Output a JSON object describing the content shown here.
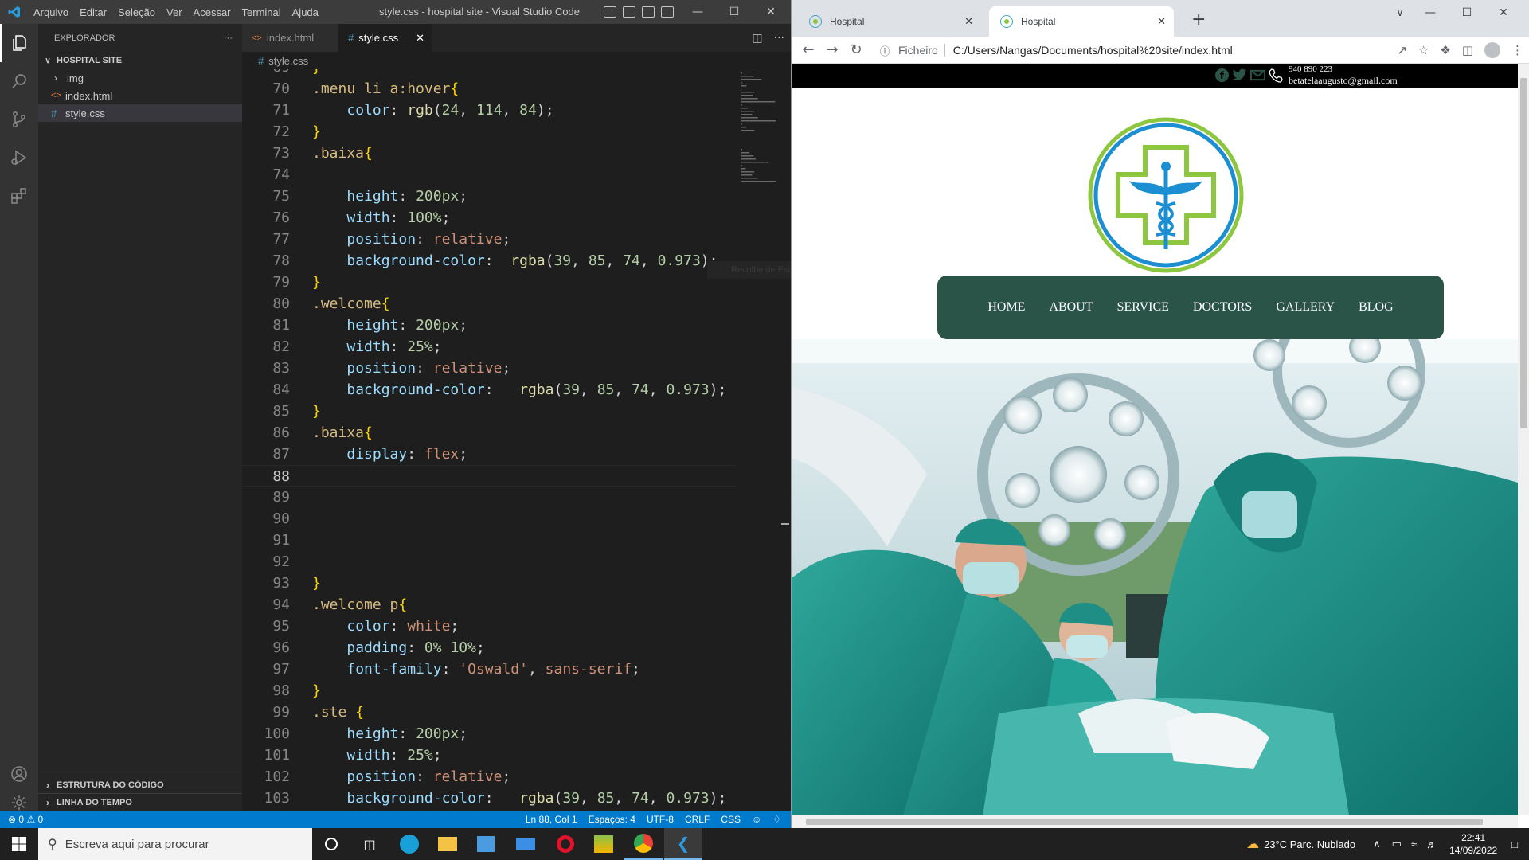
{
  "vscode": {
    "menu": [
      "Arquivo",
      "Editar",
      "Seleção",
      "Ver",
      "Acessar",
      "Terminal",
      "Ajuda"
    ],
    "window_title": "style.css - hospital site - Visual Studio Code",
    "explorer_title": "EXPLORADOR",
    "explorer_more": "···",
    "project": "HOSPITAL SITE",
    "files": [
      {
        "name": "img",
        "type": "folder"
      },
      {
        "name": "index.html",
        "type": "html"
      },
      {
        "name": "style.css",
        "type": "css",
        "selected": true
      }
    ],
    "outline_label": "ESTRUTURA DO CÓDIGO",
    "timeline_label": "LINHA DO TEMPO",
    "tabs": [
      {
        "name": "index.html",
        "active": false
      },
      {
        "name": "style.css",
        "active": true
      }
    ],
    "breadcrumb": "style.css",
    "hover_hint": "Recolhe de Este atomo",
    "current_line": 88,
    "code": [
      {
        "n": "69",
        "t": [
          [
            "t-brace",
            "}"
          ]
        ]
      },
      {
        "n": "70",
        "t": [
          [
            "t-sel",
            ".menu li a:hover"
          ],
          [
            "t-brace",
            "{"
          ]
        ]
      },
      {
        "n": "71",
        "t": [
          [
            "t-punc",
            "    "
          ],
          [
            "t-prop",
            "color"
          ],
          [
            "t-punc",
            ": "
          ],
          [
            "t-fn",
            "rgb"
          ],
          [
            "t-punc",
            "("
          ],
          [
            "t-num",
            "24"
          ],
          [
            "t-punc",
            ", "
          ],
          [
            "t-num",
            "114"
          ],
          [
            "t-punc",
            ", "
          ],
          [
            "t-num",
            "84"
          ],
          [
            "t-punc",
            ");"
          ]
        ]
      },
      {
        "n": "72",
        "t": [
          [
            "t-brace",
            "}"
          ]
        ]
      },
      {
        "n": "73",
        "t": [
          [
            "t-sel",
            ".baixa"
          ],
          [
            "t-brace",
            "{"
          ]
        ]
      },
      {
        "n": "74",
        "t": []
      },
      {
        "n": "75",
        "t": [
          [
            "t-punc",
            "    "
          ],
          [
            "t-prop",
            "height"
          ],
          [
            "t-punc",
            ": "
          ],
          [
            "t-num",
            "200px"
          ],
          [
            "t-punc",
            ";"
          ]
        ]
      },
      {
        "n": "76",
        "t": [
          [
            "t-punc",
            "    "
          ],
          [
            "t-prop",
            "width"
          ],
          [
            "t-punc",
            ": "
          ],
          [
            "t-num",
            "100%"
          ],
          [
            "t-punc",
            ";"
          ]
        ]
      },
      {
        "n": "77",
        "t": [
          [
            "t-punc",
            "    "
          ],
          [
            "t-prop",
            "position"
          ],
          [
            "t-punc",
            ": "
          ],
          [
            "t-val",
            "relative"
          ],
          [
            "t-punc",
            ";"
          ]
        ]
      },
      {
        "n": "78",
        "t": [
          [
            "t-punc",
            "    "
          ],
          [
            "t-prop",
            "background-color"
          ],
          [
            "t-punc",
            ":  "
          ],
          [
            "t-fn",
            "rgba"
          ],
          [
            "t-punc",
            "("
          ],
          [
            "t-num",
            "39"
          ],
          [
            "t-punc",
            ", "
          ],
          [
            "t-num",
            "85"
          ],
          [
            "t-punc",
            ", "
          ],
          [
            "t-num",
            "74"
          ],
          [
            "t-punc",
            ", "
          ],
          [
            "t-num",
            "0.973"
          ],
          [
            "t-punc",
            ");"
          ]
        ]
      },
      {
        "n": "79",
        "t": [
          [
            "t-brace",
            "}"
          ]
        ]
      },
      {
        "n": "80",
        "t": [
          [
            "t-sel",
            ".welcome"
          ],
          [
            "t-brace",
            "{"
          ]
        ]
      },
      {
        "n": "81",
        "t": [
          [
            "t-punc",
            "    "
          ],
          [
            "t-prop",
            "height"
          ],
          [
            "t-punc",
            ": "
          ],
          [
            "t-num",
            "200px"
          ],
          [
            "t-punc",
            ";"
          ]
        ]
      },
      {
        "n": "82",
        "t": [
          [
            "t-punc",
            "    "
          ],
          [
            "t-prop",
            "width"
          ],
          [
            "t-punc",
            ": "
          ],
          [
            "t-num",
            "25%"
          ],
          [
            "t-punc",
            ";"
          ]
        ]
      },
      {
        "n": "83",
        "t": [
          [
            "t-punc",
            "    "
          ],
          [
            "t-prop",
            "position"
          ],
          [
            "t-punc",
            ": "
          ],
          [
            "t-val",
            "relative"
          ],
          [
            "t-punc",
            ";"
          ]
        ]
      },
      {
        "n": "84",
        "t": [
          [
            "t-punc",
            "    "
          ],
          [
            "t-prop",
            "background-color"
          ],
          [
            "t-punc",
            ":   "
          ],
          [
            "t-fn",
            "rgba"
          ],
          [
            "t-punc",
            "("
          ],
          [
            "t-num",
            "39"
          ],
          [
            "t-punc",
            ", "
          ],
          [
            "t-num",
            "85"
          ],
          [
            "t-punc",
            ", "
          ],
          [
            "t-num",
            "74"
          ],
          [
            "t-punc",
            ", "
          ],
          [
            "t-num",
            "0.973"
          ],
          [
            "t-punc",
            ");"
          ]
        ]
      },
      {
        "n": "85",
        "t": [
          [
            "t-brace",
            "}"
          ]
        ]
      },
      {
        "n": "86",
        "t": [
          [
            "t-sel",
            ".baixa"
          ],
          [
            "t-brace",
            "{"
          ]
        ]
      },
      {
        "n": "87",
        "t": [
          [
            "t-punc",
            "    "
          ],
          [
            "t-prop",
            "display"
          ],
          [
            "t-punc",
            ": "
          ],
          [
            "t-val",
            "flex"
          ],
          [
            "t-punc",
            ";"
          ]
        ]
      },
      {
        "n": "88",
        "t": []
      },
      {
        "n": "89",
        "t": []
      },
      {
        "n": "90",
        "t": []
      },
      {
        "n": "91",
        "t": []
      },
      {
        "n": "92",
        "t": []
      },
      {
        "n": "93",
        "t": [
          [
            "t-brace",
            "}"
          ]
        ]
      },
      {
        "n": "94",
        "t": [
          [
            "t-sel",
            ".welcome p"
          ],
          [
            "t-brace",
            "{"
          ]
        ]
      },
      {
        "n": "95",
        "t": [
          [
            "t-punc",
            "    "
          ],
          [
            "t-prop",
            "color"
          ],
          [
            "t-punc",
            ": "
          ],
          [
            "t-val",
            "white"
          ],
          [
            "t-punc",
            ";"
          ]
        ]
      },
      {
        "n": "96",
        "t": [
          [
            "t-punc",
            "    "
          ],
          [
            "t-prop",
            "padding"
          ],
          [
            "t-punc",
            ": "
          ],
          [
            "t-num",
            "0%"
          ],
          [
            "t-punc",
            " "
          ],
          [
            "t-num",
            "10%"
          ],
          [
            "t-punc",
            ";"
          ]
        ]
      },
      {
        "n": "97",
        "t": [
          [
            "t-punc",
            "    "
          ],
          [
            "t-prop",
            "font-family"
          ],
          [
            "t-punc",
            ": "
          ],
          [
            "t-str",
            "'Oswald'"
          ],
          [
            "t-punc",
            ", "
          ],
          [
            "t-val",
            "sans-serif"
          ],
          [
            "t-punc",
            ";"
          ]
        ]
      },
      {
        "n": "98",
        "t": [
          [
            "t-brace",
            "}"
          ]
        ]
      },
      {
        "n": "99",
        "t": [
          [
            "t-sel",
            ".ste "
          ],
          [
            "t-brace",
            "{"
          ]
        ]
      },
      {
        "n": "100",
        "t": [
          [
            "t-punc",
            "    "
          ],
          [
            "t-prop",
            "height"
          ],
          [
            "t-punc",
            ": "
          ],
          [
            "t-num",
            "200px"
          ],
          [
            "t-punc",
            ";"
          ]
        ]
      },
      {
        "n": "101",
        "t": [
          [
            "t-punc",
            "    "
          ],
          [
            "t-prop",
            "width"
          ],
          [
            "t-punc",
            ": "
          ],
          [
            "t-num",
            "25%"
          ],
          [
            "t-punc",
            ";"
          ]
        ]
      },
      {
        "n": "102",
        "t": [
          [
            "t-punc",
            "    "
          ],
          [
            "t-prop",
            "position"
          ],
          [
            "t-punc",
            ": "
          ],
          [
            "t-val",
            "relative"
          ],
          [
            "t-punc",
            ";"
          ]
        ]
      },
      {
        "n": "103",
        "t": [
          [
            "t-punc",
            "    "
          ],
          [
            "t-prop",
            "background-color"
          ],
          [
            "t-punc",
            ":   "
          ],
          [
            "t-fn",
            "rgba"
          ],
          [
            "t-punc",
            "("
          ],
          [
            "t-num",
            "39"
          ],
          [
            "t-punc",
            ", "
          ],
          [
            "t-num",
            "85"
          ],
          [
            "t-punc",
            ", "
          ],
          [
            "t-num",
            "74"
          ],
          [
            "t-punc",
            ", "
          ],
          [
            "t-num",
            "0.973"
          ],
          [
            "t-punc",
            ");"
          ]
        ]
      }
    ],
    "status": {
      "errors": "0",
      "warnings": "0",
      "position": "Ln 88, Col 1",
      "spaces": "Espaços: 4",
      "encoding": "UTF-8",
      "eol": "CRLF",
      "language": "CSS"
    }
  },
  "chrome": {
    "tabs": [
      {
        "title": "Hospital",
        "active": false
      },
      {
        "title": "Hospital",
        "active": true
      }
    ],
    "new_tab": "+",
    "address_label": "Ficheiro",
    "address": "C:/Users/Nangas/Documents/hospital%20site/index.html",
    "site": {
      "phone": "940 890 223",
      "email": "betatelaaugusto@gmail.com",
      "nav": [
        "HOME",
        "ABOUT",
        "SERVICE",
        "DOCTORS",
        "GALLERY",
        "BLOG"
      ],
      "nav_color": "#2b5448",
      "logo_green": "#8dc63f",
      "logo_blue": "#1b8fd2"
    }
  },
  "taskbar": {
    "search_placeholder": "Escreva aqui para procurar",
    "weather": "23°C  Parc. Nublado",
    "time": "22:41",
    "date": "14/09/2022"
  }
}
